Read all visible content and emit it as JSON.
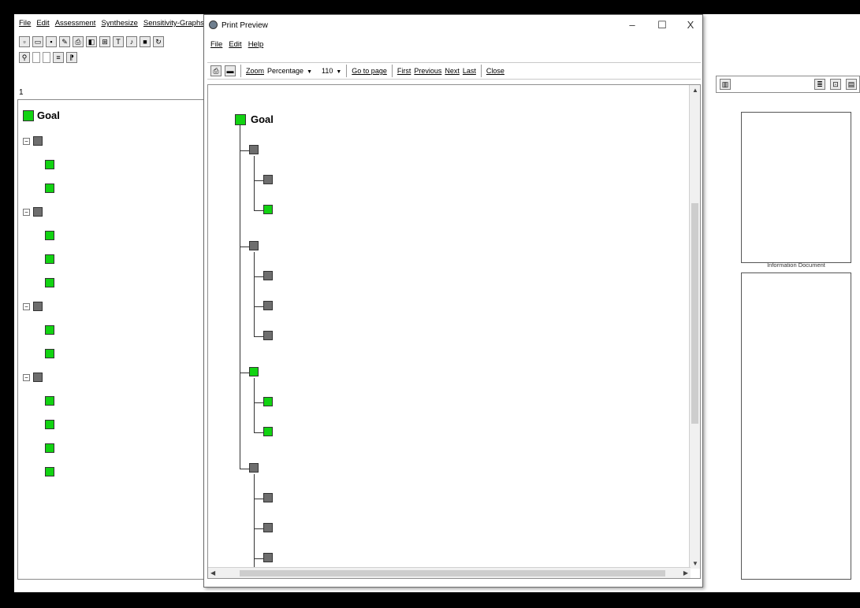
{
  "app": {
    "menu": [
      "File",
      "Edit",
      "Assessment",
      "Synthesize",
      "Sensitivity-Graphs"
    ],
    "line1": "1",
    "right_panel_label": "Information Document",
    "left_tree": {
      "goal_label": "Goal",
      "goal_text": "",
      "nodes": [
        {
          "text": ""
        },
        {
          "text": ""
        },
        {
          "text": ""
        },
        {
          "text": ""
        },
        {
          "text": ""
        },
        {
          "text": ""
        },
        {
          "text": ""
        },
        {
          "text": ""
        },
        {
          "text": ""
        },
        {
          "text": ""
        },
        {
          "text": ""
        },
        {
          "text": ""
        },
        {
          "text": ""
        },
        {
          "text": ""
        },
        {
          "text": ""
        }
      ]
    }
  },
  "dialog": {
    "title": "Print Preview",
    "controls": {
      "minimize": "–",
      "maximize": "☐",
      "close": "X"
    },
    "menu": [
      "File",
      "Edit",
      "Help"
    ],
    "toolbar": {
      "zoom_label": "Zoom",
      "zoom_mode": "Percentage",
      "zoom_value": "110",
      "goto": "Go to page",
      "first": "First",
      "previous": "Previous",
      "next": "Next",
      "last": "Last",
      "close": "Close"
    },
    "tree": {
      "goal_label": "Goal",
      "goal_text": "",
      "criteria": [
        {
          "label": "",
          "subs": [
            "",
            ""
          ]
        },
        {
          "label": "",
          "subs": [
            "",
            "",
            ""
          ]
        },
        {
          "label": "",
          "subs": [
            "",
            ""
          ]
        },
        {
          "label": "",
          "subs": [
            "",
            "",
            "",
            ""
          ]
        }
      ]
    }
  },
  "colors": {
    "green_node": "#12d312",
    "gray_node": "#6e6e6e"
  }
}
